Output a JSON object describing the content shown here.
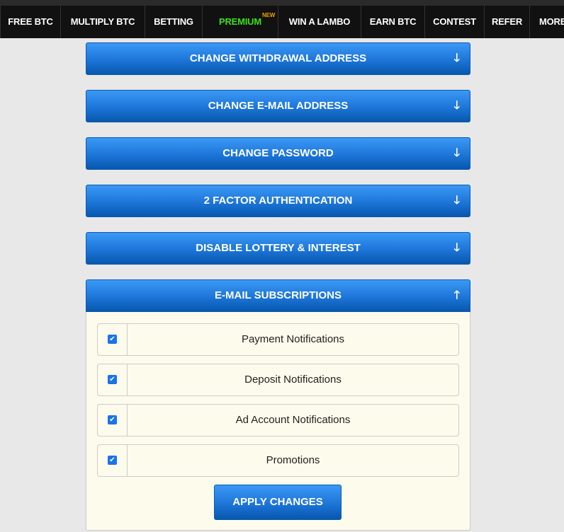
{
  "nav": {
    "items": [
      {
        "label": "FREE BTC"
      },
      {
        "label": "MULTIPLY BTC"
      },
      {
        "label": "BETTING"
      },
      {
        "label": "PREMIUM",
        "badge": "NEW"
      },
      {
        "label": "WIN A LAMBO"
      },
      {
        "label": "EARN BTC"
      },
      {
        "label": "CONTEST"
      },
      {
        "label": "REFER"
      },
      {
        "label": "MORE"
      }
    ]
  },
  "accordions": [
    {
      "title": "CHANGE WITHDRAWAL ADDRESS",
      "icon": "arrow-down-icon",
      "arrow": "🡓"
    },
    {
      "title": "CHANGE E-MAIL ADDRESS",
      "icon": "arrow-down-icon",
      "arrow": "🡓"
    },
    {
      "title": "CHANGE PASSWORD",
      "icon": "arrow-down-icon",
      "arrow": "🡓"
    },
    {
      "title": "2 FACTOR AUTHENTICATION",
      "icon": "arrow-down-icon",
      "arrow": "🡓"
    },
    {
      "title": "DISABLE LOTTERY & INTEREST",
      "icon": "arrow-down-icon",
      "arrow": "🡓"
    },
    {
      "title": "E-MAIL SUBSCRIPTIONS",
      "icon": "arrow-up-icon",
      "arrow": "🡑",
      "expanded": true
    }
  ],
  "subscriptions": {
    "options": [
      {
        "label": "Payment Notifications",
        "checked": true
      },
      {
        "label": "Deposit Notifications",
        "checked": true
      },
      {
        "label": "Ad Account Notifications",
        "checked": true
      },
      {
        "label": "Promotions",
        "checked": true
      }
    ],
    "apply_label": "APPLY CHANGES"
  },
  "colors": {
    "accent": "#1d75d8",
    "premium": "#3be01a",
    "new_badge": "#f0a000",
    "panel_bg": "#fdfbec"
  }
}
